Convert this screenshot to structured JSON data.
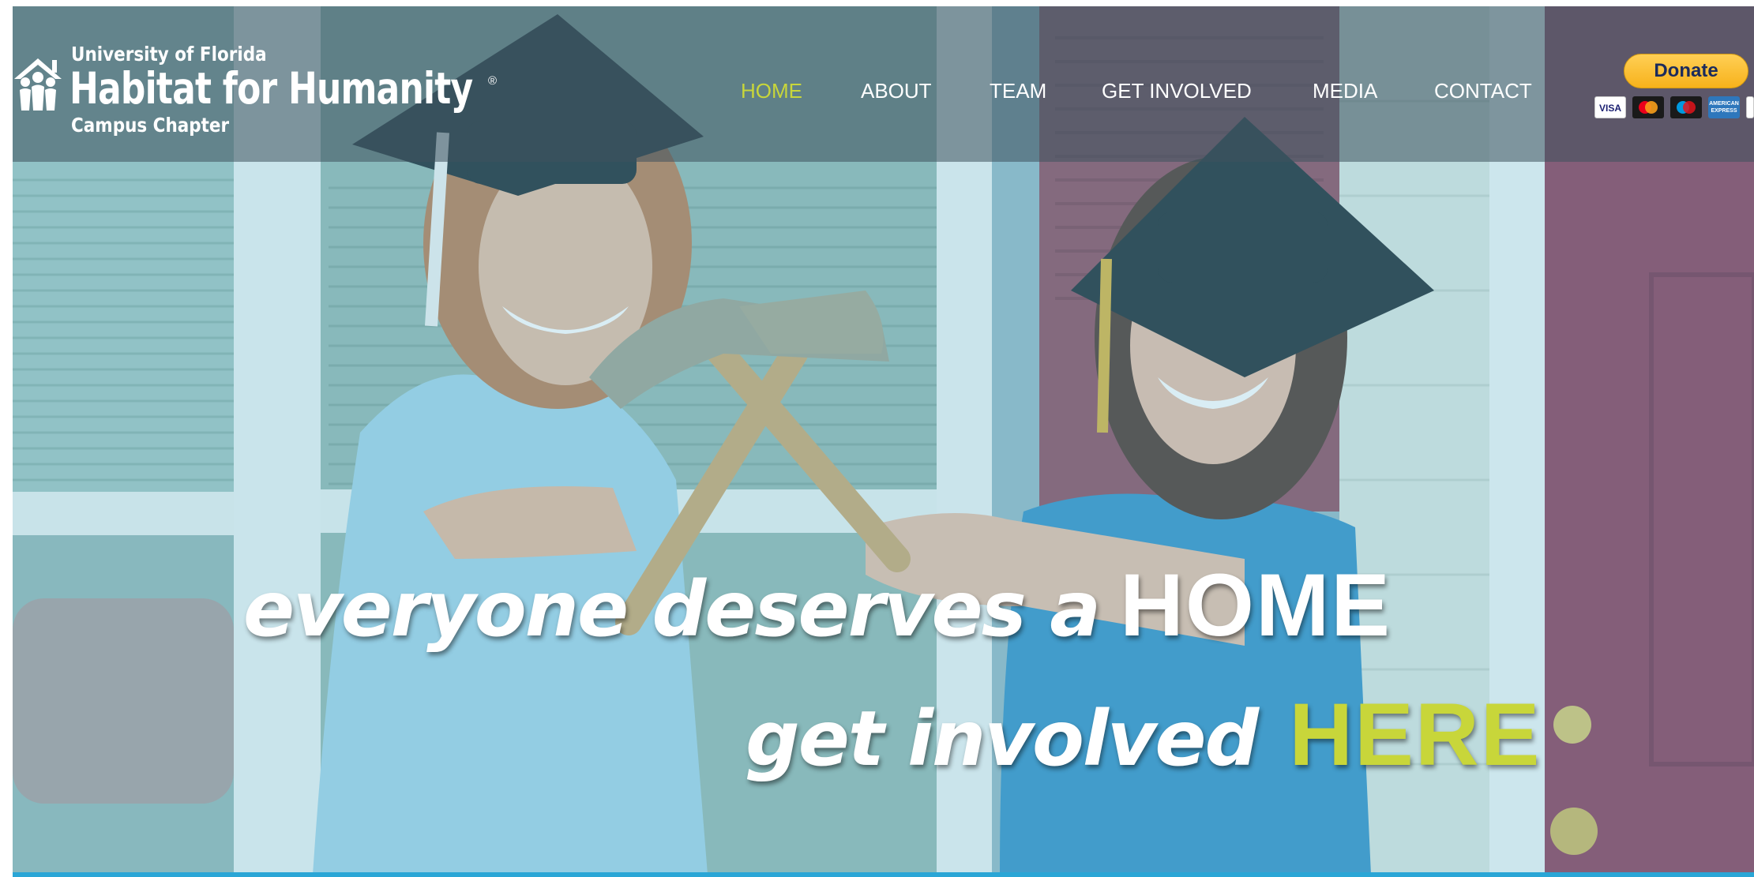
{
  "logo": {
    "line1": "University of Florida",
    "line2": "Habitat for Humanity",
    "registered": "®",
    "line3": "Campus Chapter",
    "icon": "habitat-house-people-icon"
  },
  "nav": {
    "items": [
      {
        "label": "HOME",
        "active": true
      },
      {
        "label": "ABOUT",
        "active": false
      },
      {
        "label": "TEAM",
        "active": false
      },
      {
        "label": "GET INVOLVED",
        "active": false
      },
      {
        "label": "MEDIA",
        "active": false
      },
      {
        "label": "CONTACT",
        "active": false
      }
    ],
    "active_color": "#c8d63a",
    "text_color": "#ffffff"
  },
  "donate": {
    "label": "Donate",
    "cards": [
      {
        "name": "visa-card-icon",
        "label": "VISA"
      },
      {
        "name": "mastercard-icon",
        "label": ""
      },
      {
        "name": "maestro-icon",
        "label": ""
      },
      {
        "name": "amex-card-icon",
        "label": "AMERICAN EXPRESS"
      },
      {
        "name": "discover-card-icon",
        "label": ""
      }
    ]
  },
  "hero": {
    "line1_script": "everyone deserves a",
    "line1_caps": "HOME",
    "line2_script": "get involved",
    "line2_caps": "HERE",
    "highlight_color": "#c8d63a"
  },
  "colors": {
    "header_overlay": "rgba(62,82,92,0.55)",
    "bottom_accent": "#2aa6d6",
    "door_red": "#8a3a55"
  }
}
